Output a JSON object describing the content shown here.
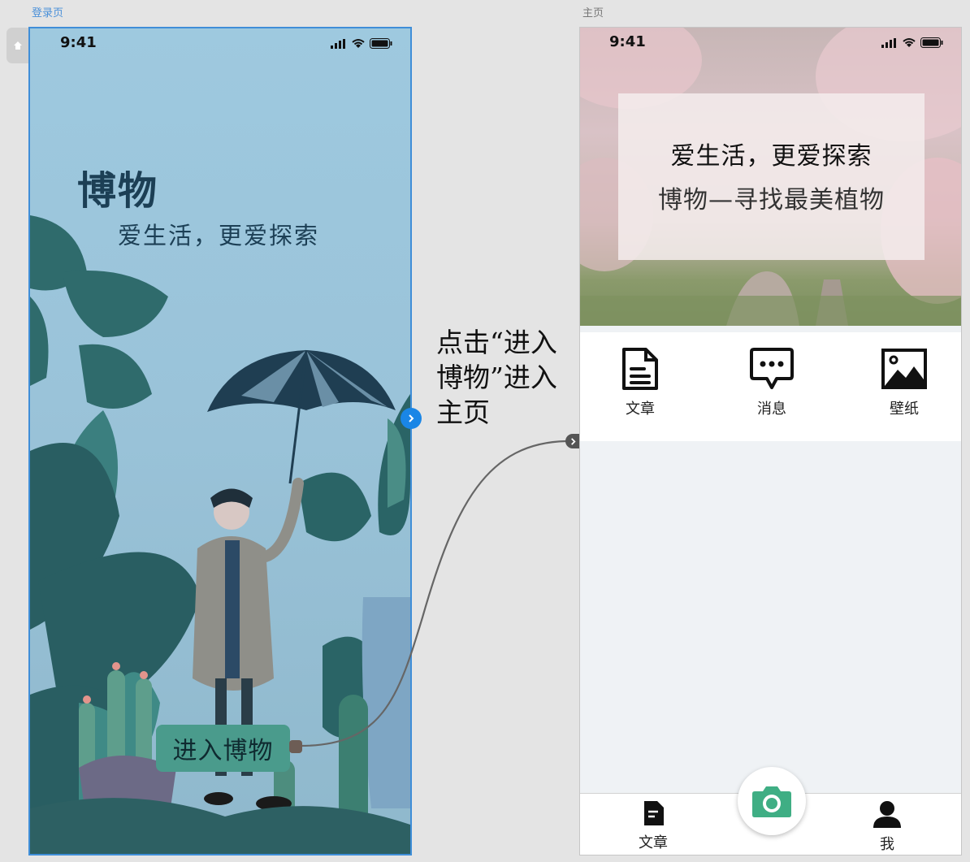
{
  "frames": {
    "login_label": "登录页",
    "home_label": "主页"
  },
  "status_bar": {
    "time": "9:41"
  },
  "login": {
    "title": "博物",
    "subtitle": "爱生活，更爱探索",
    "enter_button": "进入博物"
  },
  "annotation": {
    "line1": "点击“进入",
    "line2": "博物”进入",
    "line3": "主页"
  },
  "home": {
    "hero_line1": "爱生活，更爱探索",
    "hero_line2": "博物—寻找最美植物",
    "shortcuts": [
      {
        "label": "文章",
        "icon": "document-icon"
      },
      {
        "label": "消息",
        "icon": "message-icon"
      },
      {
        "label": "壁纸",
        "icon": "image-icon"
      }
    ],
    "tabbar": {
      "left": {
        "label": "文章",
        "icon": "document-icon"
      },
      "center": {
        "icon": "camera-icon"
      },
      "right": {
        "label": "我",
        "icon": "person-icon"
      }
    }
  },
  "colors": {
    "link_blue": "#1a86e6",
    "enter_button_bg": "#4a9b8c",
    "camera_green": "#3fae84"
  }
}
